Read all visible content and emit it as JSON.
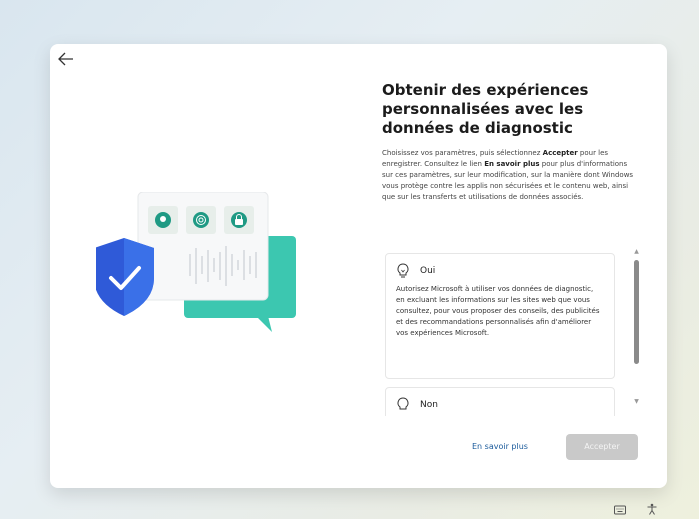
{
  "title": "Obtenir des expériences personnalisées avec les données de diagnostic",
  "description": {
    "part1": "Choisissez vos paramètres, puis sélectionnez ",
    "bold1": "Accepter",
    "part2": " pour les enregistrer. Consultez le lien ",
    "bold2": "En savoir plus",
    "part3": " pour plus d'informations sur ces paramètres, sur leur modification, sur la manière dont Windows vous protège contre les applis non sécurisées et le contenu web, ainsi que sur les transferts et utilisations de données associés."
  },
  "options": [
    {
      "label": "Oui",
      "icon": "lightbulb-icon",
      "text": "Autorisez Microsoft à utiliser vos données de diagnostic, en excluant les informations sur les sites web que vous consultez, pour vous proposer des conseils, des publicités et des recommandations personnalisés afin d'améliorer vos expériences Microsoft."
    },
    {
      "label": "Non",
      "icon": "lightbulb-off-icon",
      "text": ""
    }
  ],
  "buttons": {
    "learn_more": "En savoir plus",
    "accept": "Accepter"
  },
  "icons": {
    "back": "arrow-left-icon",
    "keyboard": "keyboard-icon",
    "accessibility": "accessibility-icon"
  },
  "colors": {
    "accent": "#1a5a9b",
    "shield": "#2f5ad8",
    "bubble": "#3cc7b0",
    "accept_disabled": "#c9c9c9"
  }
}
